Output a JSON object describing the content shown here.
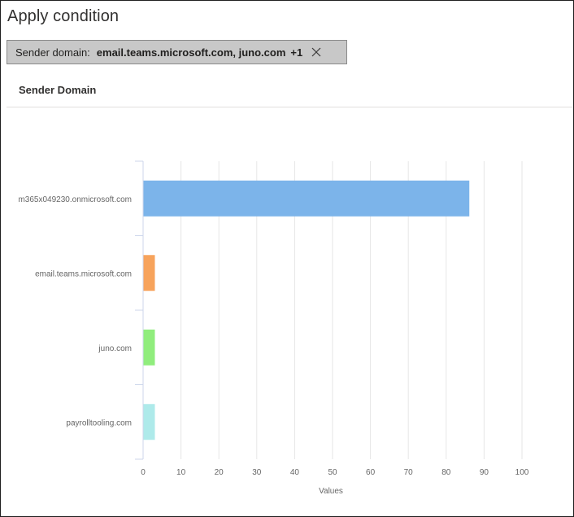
{
  "dialog": {
    "title": "Apply condition"
  },
  "filter_chip": {
    "label": "Sender domain:",
    "value": "email.teams.microsoft.com, juno.com",
    "more": "+1"
  },
  "section": {
    "title": "Sender Domain"
  },
  "chart_data": {
    "type": "bar",
    "orientation": "horizontal",
    "categories": [
      "m365x049230.onmicrosoft.com",
      "email.teams.microsoft.com",
      "juno.com",
      "payrolltooling.com"
    ],
    "values": [
      86,
      3,
      3,
      3
    ],
    "colors": [
      "#7cb4ea",
      "#f7a35c",
      "#90ed7d",
      "#aeeaea"
    ],
    "xlabel": "Values",
    "xlim": [
      0,
      100
    ],
    "xticks": [
      0,
      10,
      20,
      30,
      40,
      50,
      60,
      70,
      80,
      90,
      100
    ],
    "grid": true
  }
}
